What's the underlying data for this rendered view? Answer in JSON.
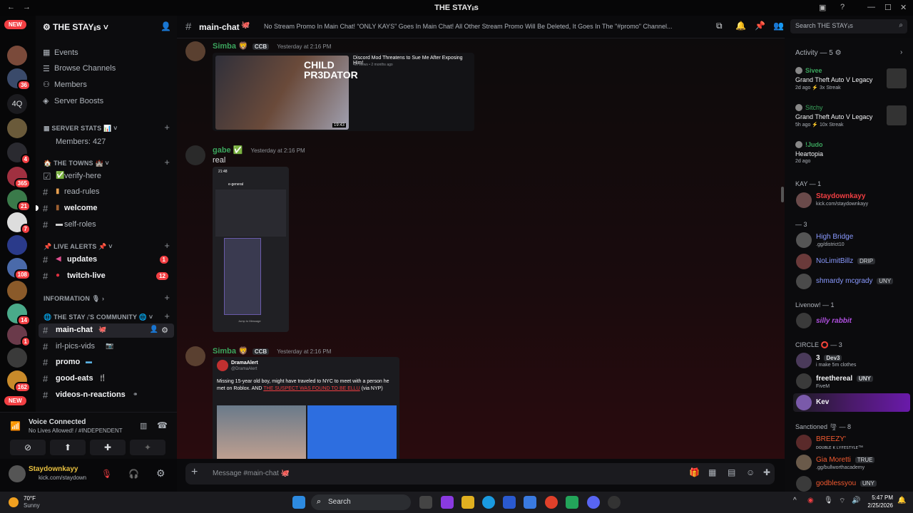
{
  "window": {
    "title": "THE STAYᵢᵢs"
  },
  "servers": {
    "new_label": "NEW",
    "badges": [
      "36",
      "4",
      "365",
      "21",
      "7",
      "108",
      "14",
      "1",
      "162"
    ],
    "short_label": "4Q"
  },
  "sidebar": {
    "server_name": "THE STAYᵢᵢs",
    "nav": [
      "Events",
      "Browse Channels",
      "Members",
      "Server Boosts"
    ],
    "server_stats": "SERVER STATS 📊",
    "members_count": "Members: 427",
    "towns": "THE TOWNS 🏰",
    "channels_towns": [
      "verify-here",
      "read-rules",
      "welcome",
      "self-roles"
    ],
    "live_alerts": "LIVE ALERTS 📌",
    "updates": "updates",
    "updates_count": "1",
    "twitch": "twitch-live",
    "twitch_count": "12",
    "information": "INFORMATION 🎙",
    "community": "THE STAY ᵢ'S COMMUNITY",
    "community_channels": [
      "main-chat",
      "irl-pics-vids",
      "promo",
      "good-eats",
      "videos-n-reactions"
    ]
  },
  "voice": {
    "status": "Voice Connected",
    "channel": "No Lives Allowed! / #INDEPENDENT"
  },
  "user": {
    "name": "Staydownkayy",
    "sub": "kick.com/staydown"
  },
  "header": {
    "channel": "main-chat",
    "topic": "No Stream Promo In Main Chat! “ONLY KAYS” Goes In Main Chat! All Other Stream Promo Will Be Deleted, It Goes In The \"#promo\" Channel...",
    "search_placeholder": "Search THE STAYᵢᵢs"
  },
  "messages": [
    {
      "user": "Simba",
      "tag": "CCB",
      "time": "Yesterday at 2:16 PM",
      "embed_title": "Discord Mod Threatens to Sue Me After Exposing Him!",
      "embed_sub": "4m views • 2 months ago",
      "thumb_text": "CHILD PR3DATOR",
      "thumb_time": "19:43"
    },
    {
      "user": "gabe",
      "time": "Yesterday at 2:16 PM",
      "text": "real",
      "phone_time": "21:48",
      "phone_channel": "e-general",
      "phone_footer": "Jump to Message"
    },
    {
      "user": "Simba",
      "tag": "CCB",
      "time": "Yesterday at 2:16 PM",
      "tweet_author": "DramaAlert",
      "tweet_handle": "@DramaAlert",
      "tweet_text": "Missing 15-year old boy, might have traveled to NYC to meet with a person he met on Roblox. AND",
      "tweet_highlight": "THE SUSPECT WAS FOUND TO BE ELLU",
      "tweet_end": "(via NYP)"
    }
  ],
  "composer": {
    "placeholder": "Message #main-chat 🐙"
  },
  "members": {
    "activity": "Activity — 5",
    "act": [
      {
        "name": "Sivee",
        "game": "Grand Theft Auto V Legacy",
        "meta": "2d ago  ⚡ 3x Streak"
      },
      {
        "name": "Sitchy",
        "game": "Grand Theft Auto V Legacy",
        "meta": "5h ago  ⚡ 10x Streak"
      },
      {
        "name": "!Judo",
        "game": "Heartopia",
        "meta": "2d ago"
      }
    ],
    "kay_header": "KAY — 1",
    "kay": {
      "name": "Staydownkayy",
      "sub": "kick.com/staydownkayy"
    },
    "group3_header": "— 3",
    "group3": [
      {
        "name": "High Bridge",
        "sub": ".gg/district10"
      },
      {
        "name": "NoLimitBillz",
        "tag": "DRIP"
      },
      {
        "name": "shmardy mcgrady",
        "tag": "UNY"
      }
    ],
    "livenow_header": "Livenow! — 1",
    "livenow": {
      "name": "silly rabbit"
    },
    "circle_header": "CIRCLE ⭕ — 3",
    "circle": [
      {
        "name": "3",
        "tag": "Dev3",
        "sub": "i make 5m clothes"
      },
      {
        "name": "freethereal",
        "tag": "UNY",
        "sub": "FiveM"
      },
      {
        "name": "Kev"
      }
    ],
    "sanctioned_header": "Sanctioned 🌪 — 8",
    "sanctioned": [
      {
        "name": "BREEZY'",
        "sub": "ᴅᴏᴜʙʟᴇ ᴋ ʟʏꜰᴇꜱᴛʏʟᴇ™"
      },
      {
        "name": "Gia Moretti",
        "tag": "TRUE",
        "sub": ".gg/bullworthacademy"
      },
      {
        "name": "godblessyou",
        "tag": "UNY"
      }
    ]
  },
  "taskbar": {
    "weather_temp": "70°F",
    "weather_desc": "Sunny",
    "search": "Search",
    "time": "5:47 PM",
    "date": "2/25/2026"
  }
}
